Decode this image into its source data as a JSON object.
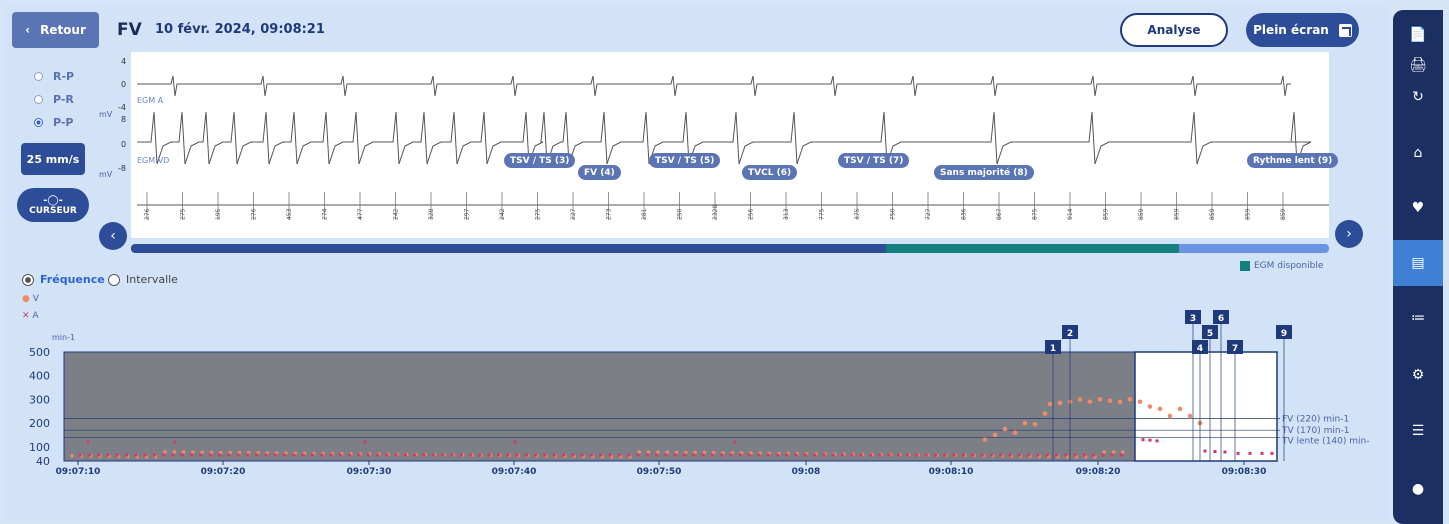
{
  "header": {
    "back_label": "Retour",
    "title": "FV",
    "datetime": "10 févr. 2024, 09:08:21",
    "analyse_label": "Analyse",
    "fullscreen_label": "Plein écran"
  },
  "left": {
    "radios": [
      "R-P",
      "P-R",
      "P-P"
    ],
    "selected_radio": "P-P",
    "speed_label": "25 mm/s",
    "cursor_label": "CURSEUR"
  },
  "egm": {
    "channel_a": "EGM A",
    "channel_vd": "EGM VD",
    "unit": "mV",
    "a_ticks": [
      "4",
      "0",
      "-4"
    ],
    "v_ticks": [
      "8",
      "0",
      "-8"
    ],
    "episodes": [
      "TSV / TS (3)",
      "FV (4)",
      "TSV / TS (5)",
      "TVCL (6)",
      "TSV / TS (7)",
      "Sans majorité (8)",
      "Rythme lent (9)"
    ],
    "intervals": [
      "276",
      "275",
      "195",
      "276",
      "453",
      "274",
      "477",
      "242",
      "328",
      "297",
      "242",
      "275",
      "227",
      "273",
      "281",
      "250",
      "2328",
      "256",
      "313",
      "775",
      "375",
      "750",
      "727",
      "836",
      "867",
      "875",
      "914",
      "859",
      "859",
      "859",
      "859",
      "859",
      "859"
    ],
    "egm_available_label": "EGM disponible"
  },
  "chart": {
    "mode_options": [
      "Fréquence",
      "Intervalle"
    ],
    "selected_mode": "Fréquence",
    "legend_v": "V",
    "legend_a": "A",
    "y_unit": "min-1",
    "y_ticks": [
      "500",
      "400",
      "300",
      "200",
      "100",
      "40"
    ],
    "x_ticks": [
      "09:07:10",
      "09:07:20",
      "09:07:30",
      "09:07:40",
      "09:07:50",
      "09:08",
      "09:08:10",
      "09:08:20",
      "09:08:30"
    ],
    "zone_labels": [
      "FV (220) min-1",
      "TV (170) min-1",
      "TV lente (140) min-"
    ],
    "markers": [
      "1",
      "2",
      "3",
      "4",
      "5",
      "6",
      "7",
      "9"
    ]
  },
  "chart_data": {
    "type": "scatter",
    "ylabel": "min-1",
    "ylim": [
      40,
      500
    ],
    "thresholds": [
      {
        "label": "FV (220) min-1",
        "value": 220
      },
      {
        "label": "TV (170) min-1",
        "value": 170
      },
      {
        "label": "TV lente (140) min-",
        "value": 140
      }
    ],
    "series": [
      {
        "name": "V",
        "color": "#f08a6a",
        "note_rate": "approx 77 bpm baseline, rising to ~280 near 09:08:17"
      },
      {
        "name": "A",
        "color": "#d23a6a"
      }
    ]
  },
  "nav": {
    "items": [
      "document-icon",
      "print-icon",
      "sync-icon",
      "home-icon",
      "heart-icon",
      "egm-icon",
      "stats-icon",
      "settings-icon",
      "report-icon",
      "user-icon"
    ],
    "active": "egm-icon",
    "colors": {
      "nav_bg": "#1b2f63",
      "active": "#3f7fd6"
    }
  }
}
